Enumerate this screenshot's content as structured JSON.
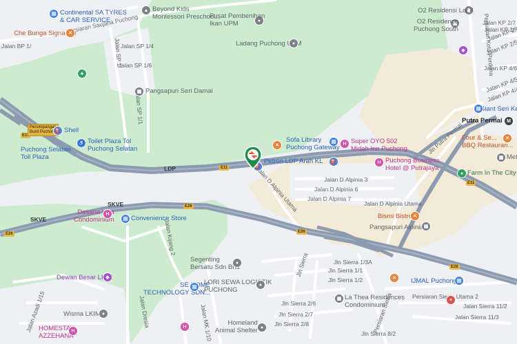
{
  "map": {
    "colors": {
      "green_area": "#cdeccf",
      "urban": "#eef0f3",
      "sand": "#f3ead7",
      "highway": "#8c9bb0",
      "road": "#ffffff",
      "marker": "#1e8a4c"
    },
    "highways": {
      "ldp": "LDP",
      "skve_left": "SKVE",
      "skve_mid": "SKVE",
      "e11_a": "E11",
      "e11_b": "E11",
      "e11_c": "E11",
      "e26_a": "E26",
      "e26_b": "E26",
      "e26_c": "E26",
      "e26_d": "E26"
    },
    "pois": [
      {
        "id": "continental",
        "text": "Continental SA TYRES\n& CAR SERVICE",
        "icon": "shop-icon",
        "color": "blue"
      },
      {
        "id": "beyond-kids",
        "text": "Beyond Kids\nMontessori Preschool...",
        "icon": "school-icon",
        "color": "gray"
      },
      {
        "id": "pusat",
        "text": "Pusat Pembenihan\nIkan UPM",
        "icon": "place-icon",
        "color": "gray"
      },
      {
        "id": "o2-lot8",
        "text": "O2 Residensi Lot 8",
        "icon": "building-icon",
        "color": "gray"
      },
      {
        "id": "o2-south",
        "text": "O2 Residence\nPuchong South",
        "icon": "building-icon",
        "color": "gray"
      },
      {
        "id": "che-bunga",
        "text": "Che Bunga Signature",
        "icon": "restaurant-icon",
        "color": "orange"
      },
      {
        "id": "ladang",
        "text": "Ladang Puchong UPM",
        "icon": "place-icon",
        "color": "gray"
      },
      {
        "id": "pangsapuri-seri",
        "text": "Pangsapuri Seri Damai",
        "icon": "building-icon",
        "color": "gray"
      },
      {
        "id": "shell",
        "text": "Shell",
        "icon": "fuel-icon",
        "color": "blue"
      },
      {
        "id": "toll-plaza",
        "text": "Toilet Plaza Tol\nPuchong Selatan",
        "icon": "toilet-icon",
        "color": "blue"
      },
      {
        "id": "puchong-toll",
        "text": "Puchong Selatan\nToll Plaza",
        "icon": "toll-icon",
        "color": "blue"
      },
      {
        "id": "sofa-library",
        "text": "Sofa Library\nPuchong Gateway",
        "icon": "shop-icon",
        "color": "blue"
      },
      {
        "id": "super-oyo",
        "text": "Super OYO 502\nMidah Inn Puchong",
        "icon": "hotel-icon",
        "color": "pink"
      },
      {
        "id": "petron",
        "text": "Petron LDP Arah KL",
        "icon": "fuel-icon",
        "color": "blue"
      },
      {
        "id": "puchong-business",
        "text": "Puchong Business\nHotel @ Putrajaya",
        "icon": "hotel-icon",
        "color": "pink"
      },
      {
        "id": "giant",
        "text": "Giant Seri Kemb...",
        "icon": "cart-icon",
        "color": "blue"
      },
      {
        "id": "putra-permai",
        "text": "Putra Permai",
        "icon": "transit-icon",
        "color": "dark"
      },
      {
        "id": "four-season",
        "text": "Four & Se...\nBBQ Restauran...",
        "icon": "restaurant-icon",
        "color": "orange"
      },
      {
        "id": "meta-res",
        "text": "Meta Res...",
        "icon": "building-icon",
        "color": "gray"
      },
      {
        "id": "farm-city",
        "text": "Farm In The City",
        "icon": "place-icon",
        "color": "green"
      },
      {
        "id": "desana",
        "text": "Desana Villa\nCondominium",
        "icon": "hotel-icon",
        "color": "pink"
      },
      {
        "id": "convenience",
        "text": "Convenience Store",
        "icon": "store-icon",
        "color": "blue"
      },
      {
        "id": "bismi",
        "text": "Bismi Bistro",
        "icon": "restaurant-icon",
        "color": "orange"
      },
      {
        "id": "pangsapuri-alpinia",
        "text": "Pangsapuri Alpinia",
        "icon": "building-icon",
        "color": "gray"
      },
      {
        "id": "segenting",
        "text": "Segenting\nBersatu Sdn Bhd",
        "icon": "place-icon",
        "color": "gray"
      },
      {
        "id": "dewan",
        "text": "Dewan Besar LKIM",
        "icon": "hall-icon",
        "color": "purple"
      },
      {
        "id": "se-home",
        "text": "SE HOME\nTECHNOLOGY SDN...",
        "icon": "shop-icon",
        "color": "blue"
      },
      {
        "id": "lori-sewa",
        "text": "LORI SEWA LOGISTIK\nPUCHONG",
        "icon": "place-icon",
        "color": "gray"
      },
      {
        "id": "ijmal",
        "text": "IJMAL Puchong",
        "icon": "shop-icon",
        "color": "blue"
      },
      {
        "id": "la-thea",
        "text": "La Thea Residences\nCondominium",
        "icon": "building-icon",
        "color": "gray"
      },
      {
        "id": "wisma",
        "text": "Wisma LKIM",
        "icon": "place-icon",
        "color": "gray"
      },
      {
        "id": "homestay",
        "text": "HOMESTAY\nAZZEHANA",
        "icon": "hotel-icon",
        "color": "pink"
      },
      {
        "id": "homeland",
        "text": "Homeland\nAnimal Shelter",
        "icon": "place-icon",
        "color": "gray"
      }
    ],
    "roads": {
      "persiaran_saujana": "Persiaran Saujana Puchong",
      "jalan_sp1_4": "Jalan SP 1/4",
      "jalan_sp1_6": "Jalan SP 1/6",
      "jalan_sp1_a": "Jalan SP 1/",
      "jalan_sp1_1": "Jalan SP 1/1",
      "jalan_bp": "Jalan BP 1/",
      "jalan_kp27": "Jalan KP 2/7",
      "jalan_kp26": "Jalan KP 2/6",
      "jalan_kp25": "Jalan KP 2/5",
      "jalan_kp46": "Jalan KP 4/6",
      "jalan_kp45": "Jalan KP 4/5",
      "jalan_kp44": "Jalan KP 4/4",
      "jalan_kp1": "Jalan KP 1/",
      "persiaran_kota": "Persiaran Kota Perdana",
      "jln_putra_permai": "Jln Putra Permai",
      "jalan_alpinia_3": "Jalan D Alpinia 3",
      "jalan_alpinia_6": "Jalan D Alpinia 6",
      "jalan_alpinia_7": "Jalan D Alpinia 7",
      "jalan_alpinia_utama_a": "Jalan D Alpinia Utama",
      "jalan_alpinia_utama_b": "Jalan D Alpinia Utama",
      "jln_sierra_13a": "Jln Sierra 1/3A",
      "jln_sierra_11": "Jln Sierra 1/1",
      "jln_sierra_12": "Jln Sierra 1/2",
      "jln_sierra": "Jln Sierra",
      "jln_sierra_26": "Jln Sierra 2/6",
      "jln_sierra_27": "Jln Sierra 2/7",
      "jln_sierra_28": "Jln Sierra 2/8",
      "persiaran_sierra_utama": "Persiaran Sierra Utama 2",
      "jalan_sierra_112": "Jalan Sierra 11/2",
      "jalan_sierra_113": "Jalan Sierra 11/3",
      "jalan_sierra_82": "Jln Sierra 8/2",
      "persiaran_sierra": "Persiaran Sierra",
      "jalan_kijang": "Jalan Kijang 2",
      "jalan_dresia": "Jalan Dresia",
      "jalan_azadi": "Jalan Azadi 1/15",
      "jalan_mk": "Jalan MK 1/10"
    },
    "signs": {
      "toll_sign": "Persimpangan\nBukit Puchong"
    }
  }
}
